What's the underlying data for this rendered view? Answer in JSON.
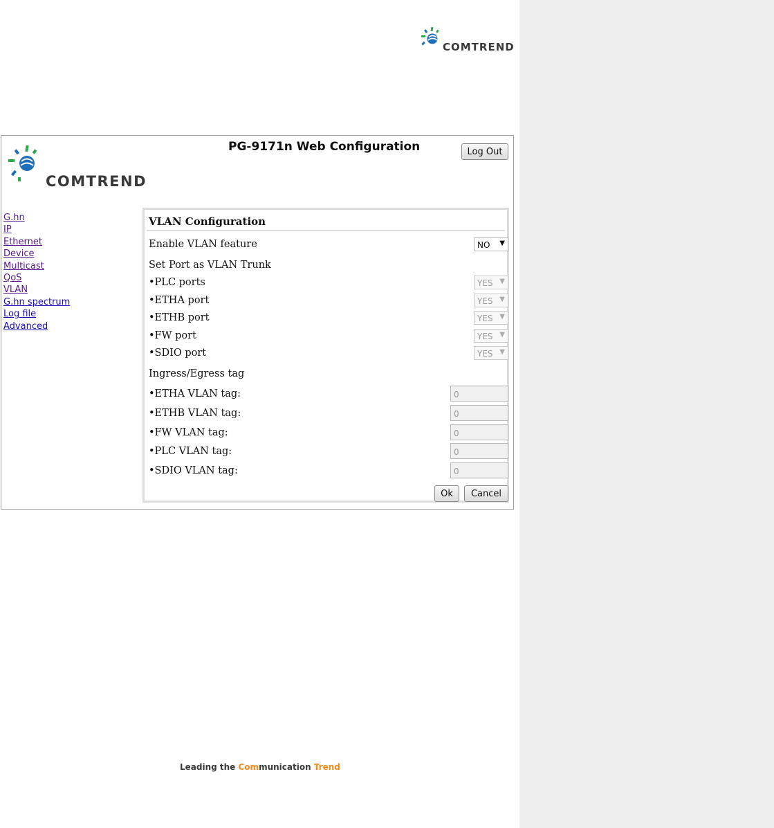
{
  "document": {
    "brand": "COMTREND",
    "tagline": {
      "part1": "Leading the ",
      "part2": "Com",
      "part3": "munication ",
      "part4": "Trend"
    }
  },
  "app": {
    "title": "PG-9171n Web Configuration",
    "logout_label": "Log Out",
    "brand": "COMTREND"
  },
  "nav": {
    "items": [
      "G.hn",
      "IP",
      "Ethernet",
      "Device",
      "Multicast",
      "QoS",
      "VLAN",
      "G.hn spectrum",
      "Log file",
      "Advanced"
    ]
  },
  "vlan": {
    "title": "VLAN Configuration",
    "enable_label": "Enable VLAN feature",
    "enable_value": "NO",
    "trunk_heading": "Set Port as VLAN Trunk",
    "trunk_ports": [
      {
        "label": "•PLC ports",
        "value": "YES"
      },
      {
        "label": "•ETHA port",
        "value": "YES"
      },
      {
        "label": "•ETHB port",
        "value": "YES"
      },
      {
        "label": "•FW port",
        "value": "YES"
      },
      {
        "label": "•SDIO port",
        "value": "YES"
      }
    ],
    "tag_heading": "Ingress/Egress tag",
    "tags": [
      {
        "label": "•ETHA VLAN tag:",
        "value": "0"
      },
      {
        "label": "•ETHB VLAN tag:",
        "value": "0"
      },
      {
        "label": "•FW VLAN tag:",
        "value": "0"
      },
      {
        "label": "•PLC VLAN tag:",
        "value": "0"
      },
      {
        "label": "•SDIO VLAN tag:",
        "value": "0"
      }
    ],
    "ok_label": "Ok",
    "cancel_label": "Cancel"
  },
  "colors": {
    "accent_orange": "#f28a1c",
    "logo_blue": "#1f6fb8",
    "logo_green": "#2aa84a",
    "link_visited": "#551a8b",
    "link_unvisited": "#1a0dab"
  },
  "icons": {
    "logo": "comtrend-burst-logo",
    "dropdown": "chevron-down-icon"
  }
}
